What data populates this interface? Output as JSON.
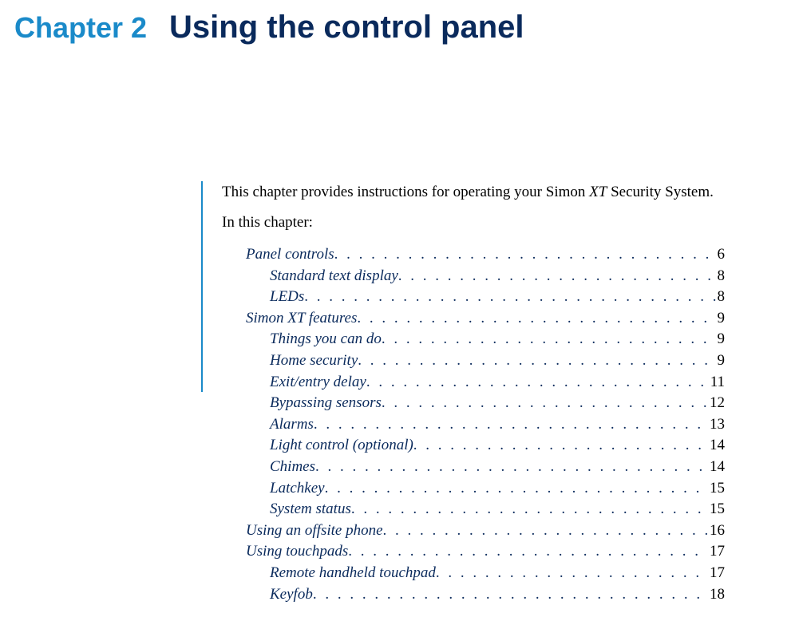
{
  "header": {
    "chapter_label": "Chapter 2",
    "title": "Using the control panel"
  },
  "intro": {
    "text_before_italic": "This chapter provides instructions for operating your Simon ",
    "italic_word": "XT",
    "text_after_italic": " Security System."
  },
  "in_this_chapter": "In this chapter:",
  "toc": [
    {
      "label": "Panel controls",
      "page": "6",
      "level": 0
    },
    {
      "label": "Standard text display",
      "page": "8",
      "level": 1
    },
    {
      "label": "LEDs",
      "page": "8",
      "level": 1
    },
    {
      "label": "Simon XT features",
      "page": "9",
      "level": 0
    },
    {
      "label": "Things you can do",
      "page": "9",
      "level": 1
    },
    {
      "label": "Home security",
      "page": "9",
      "level": 1
    },
    {
      "label": "Exit/entry delay",
      "page": "11",
      "level": 1
    },
    {
      "label": "Bypassing sensors",
      "page": "12",
      "level": 1
    },
    {
      "label": "Alarms",
      "page": "13",
      "level": 1
    },
    {
      "label": "Light control (optional)",
      "page": "14",
      "level": 1
    },
    {
      "label": "Chimes",
      "page": "14",
      "level": 1
    },
    {
      "label": "Latchkey",
      "page": "15",
      "level": 1
    },
    {
      "label": "System status",
      "page": "15",
      "level": 1
    },
    {
      "label": "Using an offsite phone",
      "page": "16",
      "level": 0
    },
    {
      "label": "Using touchpads",
      "page": "17",
      "level": 0
    },
    {
      "label": "Remote handheld touchpad",
      "page": "17",
      "level": 1
    },
    {
      "label": "Keyfob",
      "page": "18",
      "level": 1
    }
  ]
}
